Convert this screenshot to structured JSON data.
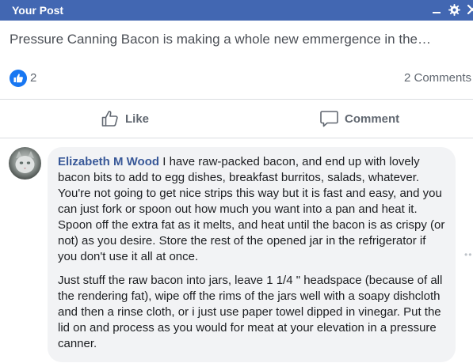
{
  "window": {
    "title": "Your Post",
    "controls": [
      "minimize-icon",
      "gear-icon",
      "close-icon"
    ]
  },
  "post": {
    "preview_text": "Pressure Canning Bacon is making a whole new emmergence in the…",
    "reaction_count": "2",
    "comment_count": "2 Comments",
    "reaction_icon": "like-icon"
  },
  "actions": {
    "like_label": "Like",
    "comment_label": "Comment"
  },
  "comment": {
    "author": "Elizabeth M Wood",
    "paragraph1": "I have raw-packed bacon, and end up with lovely bacon bits to add to egg dishes, breakfast burritos, salads, whatever. You're not going to get nice strips this way but it is fast and easy, and you can just fork or spoon out how much you want into a pan and heat it. Spoon off the extra fat as it melts, and heat until the bacon is as crispy (or not) as you desire. Store the rest of the opened jar in the refrigerator if you don't use it all at once.",
    "paragraph2": "Just stuff the raw bacon into jars, leave 1 1/4 \" headspace (because of all the rendering fat), wipe off the rims of the jars well with a soapy dishcloth and then a rinse cloth, or i just use paper towel dipped in vinegar. Put the lid on and process as you would for meat at your elevation in a pressure canner."
  },
  "colors": {
    "header_bg": "#4267b2",
    "author_link": "#385898",
    "bubble_bg": "#f2f3f5",
    "like_badge": "#1877f2",
    "muted_text": "#606770"
  }
}
